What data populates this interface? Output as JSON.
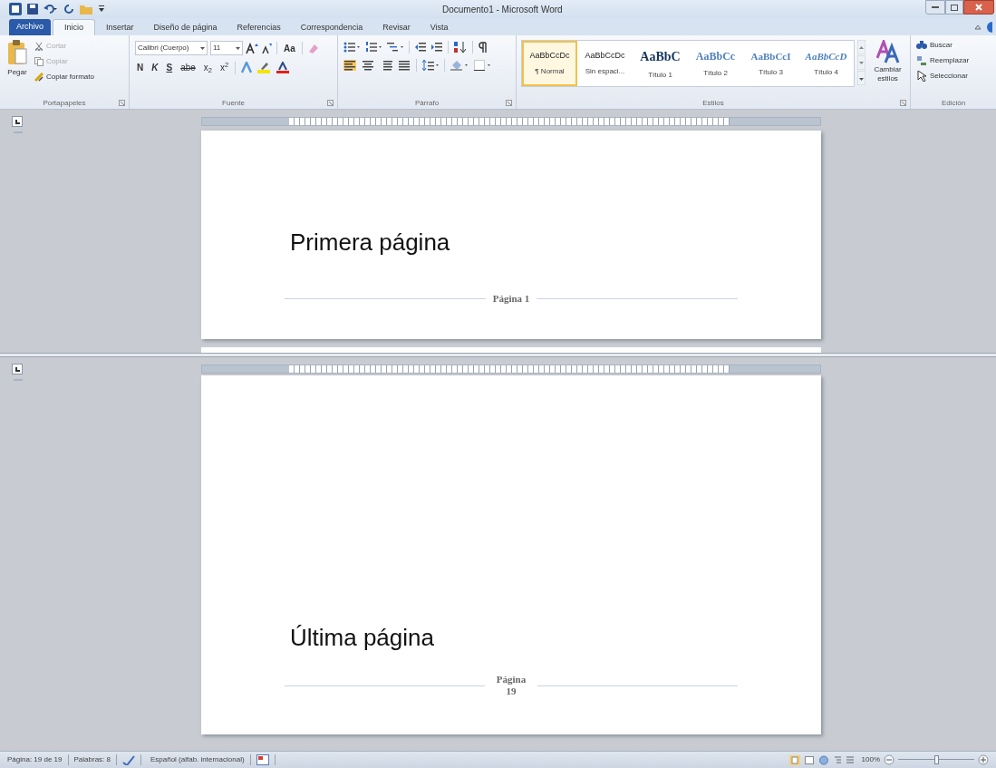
{
  "window": {
    "title": "Documento1 - Microsoft Word"
  },
  "tabs": [
    {
      "label": "Archivo",
      "kind": "file",
      "selected": false
    },
    {
      "label": "Inicio",
      "kind": "tab",
      "selected": true
    },
    {
      "label": "Insertar",
      "kind": "tab",
      "selected": false
    },
    {
      "label": "Diseño de página",
      "kind": "tab",
      "selected": false
    },
    {
      "label": "Referencias",
      "kind": "tab",
      "selected": false
    },
    {
      "label": "Correspondencia",
      "kind": "tab",
      "selected": false
    },
    {
      "label": "Revisar",
      "kind": "tab",
      "selected": false
    },
    {
      "label": "Vista",
      "kind": "tab",
      "selected": false
    }
  ],
  "clipboard": {
    "label": "Portapapeles",
    "paste": "Pegar",
    "items": [
      {
        "label": "Cortar",
        "disabled": true
      },
      {
        "label": "Copiar",
        "disabled": true
      },
      {
        "label": "Copiar formato",
        "disabled": false
      }
    ]
  },
  "font": {
    "label": "Fuente",
    "font_name": "Calibri (Cuerpo)",
    "font_size": "11",
    "change_case": "Aa",
    "format_buttons": [
      "N",
      "K",
      "S",
      "abe",
      "x$_{2}$",
      "x$^{2}$"
    ]
  },
  "paragraph": {
    "label": "Párrafo"
  },
  "styles": {
    "label": "Estilos",
    "items": [
      {
        "preview": "AaBbCcDc",
        "name": "¶ Normal",
        "kind": "plain",
        "selected": true
      },
      {
        "preview": "AaBbCcDc",
        "name": "Sin espaci...",
        "kind": "plain",
        "selected": false
      },
      {
        "preview": "AaBbC",
        "name": "Título 1",
        "kind": "heading1",
        "selected": false
      },
      {
        "preview": "AaBbCc",
        "name": "Título 2",
        "kind": "heading2",
        "selected": false
      },
      {
        "preview": "AaBbCcI",
        "name": "Título 3",
        "kind": "heading3",
        "selected": false
      },
      {
        "preview": "AaBbCcD",
        "name": "Título 4",
        "kind": "heading4",
        "selected": false
      }
    ],
    "change_styles": "Cambiar estilos"
  },
  "editing": {
    "label": "Edición",
    "items": [
      "Buscar",
      "Reemplazar",
      "Seleccionar"
    ]
  },
  "panes": [
    {
      "body": "Primera página",
      "footer": "Página 1"
    },
    {
      "body": "Última página",
      "footer": "Página 19"
    }
  ],
  "status_bar": {
    "page": "Página: 19 de 19",
    "words": "Palabras: 8",
    "language": "Español (alfab. internacional)",
    "zoom": "100%",
    "zoom_level": {
      "level": 0.5
    }
  }
}
